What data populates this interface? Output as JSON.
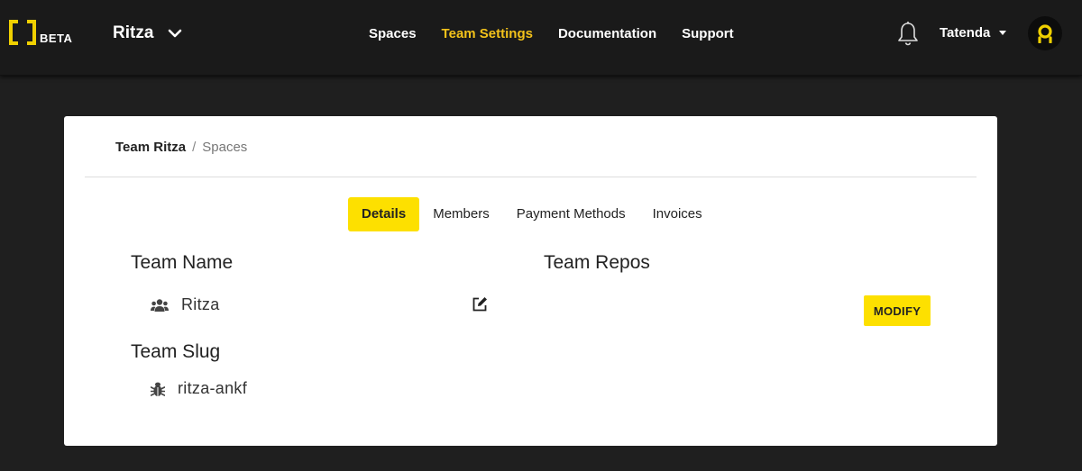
{
  "navbar": {
    "logo_badge": "BETA",
    "team_name": "Ritza",
    "links": [
      "Spaces",
      "Team Settings",
      "Documentation",
      "Support"
    ],
    "active_link": "Team Settings",
    "user_name": "Tatenda"
  },
  "breadcrumb": {
    "team": "Team Ritza",
    "separator": "/",
    "current": "Spaces"
  },
  "tabs": [
    "Details",
    "Members",
    "Payment Methods",
    "Invoices"
  ],
  "active_tab": "Details",
  "details": {
    "team_name_title": "Team Name",
    "team_name_value": "Ritza",
    "team_slug_title": "Team Slug",
    "team_slug_value": "ritza-ankf",
    "team_repos_title": "Team Repos",
    "modify_label": "MODIFY"
  },
  "colors": {
    "accent": "#fde000",
    "nav_active": "#f3c21a",
    "nav_background": "#1a1a1a",
    "page_background": "#1f1f1f"
  },
  "icons": {
    "team_name": "users-icon",
    "team_slug": "bug-icon",
    "edit": "edit-icon",
    "notifications": "bell-icon",
    "team_switch": "chevron-down-icon"
  }
}
